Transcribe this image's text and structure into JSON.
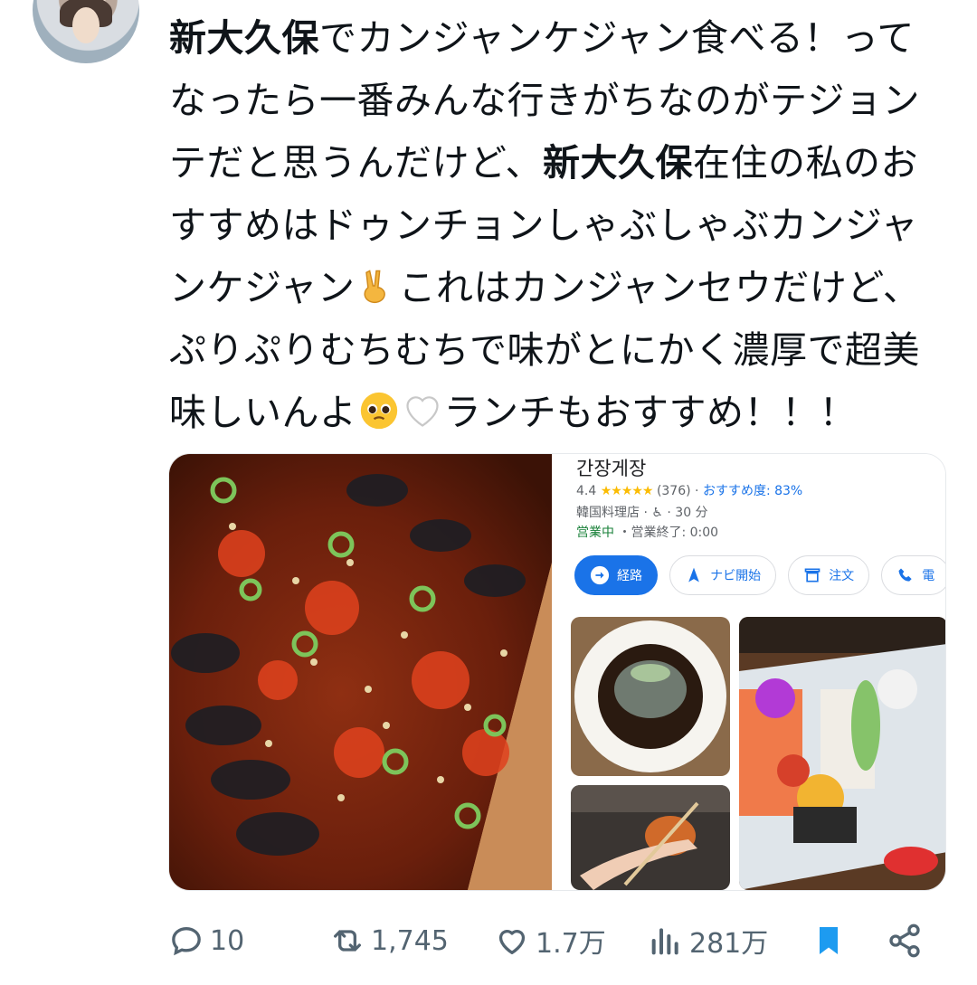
{
  "tweet": {
    "segments": [
      {
        "text": "新大久保",
        "bold": true
      },
      {
        "text": "でカンジャンケジャン食べる！ってなったら一番みんな行きがちなのがテジョンテだと思うんだけど、",
        "bold": false
      },
      {
        "text": "新大久保",
        "bold": true
      },
      {
        "text": "在住の私のおすすめはドゥンチョンしゃぶしゃぶカンジャンケジャン",
        "bold": false
      },
      {
        "emoji": "victory-hand"
      },
      {
        "text": "これはカンジャンセウだけど、ぷりぷりむちむちで味がとにかく濃厚で超美味しいんよ",
        "bold": false
      },
      {
        "emoji": "pleading-face"
      },
      {
        "emoji": "white-heart"
      },
      {
        "text": "ランチもおすすめ！！！",
        "bold": false
      }
    ]
  },
  "maps_card": {
    "title": "간장게장",
    "rating": "4.4",
    "stars": "★★★★★",
    "review_count": "(376)",
    "recommend": "おすすめ度: 83%",
    "category": "韓国料理店",
    "wheelchair": "♿",
    "walk": "30 分",
    "status_open": "営業中",
    "status_close": "・営業終了: 0:00",
    "buttons": {
      "route": "経路",
      "navigate": "ナビ開始",
      "order": "注文",
      "call": "電"
    }
  },
  "actions": {
    "replies": "10",
    "retweets": "1,745",
    "likes": "1.7万",
    "views": "281万"
  },
  "colors": {
    "accent": "#1d9bf0",
    "maps_blue": "#1a73e8",
    "icon_gray": "#536471"
  }
}
